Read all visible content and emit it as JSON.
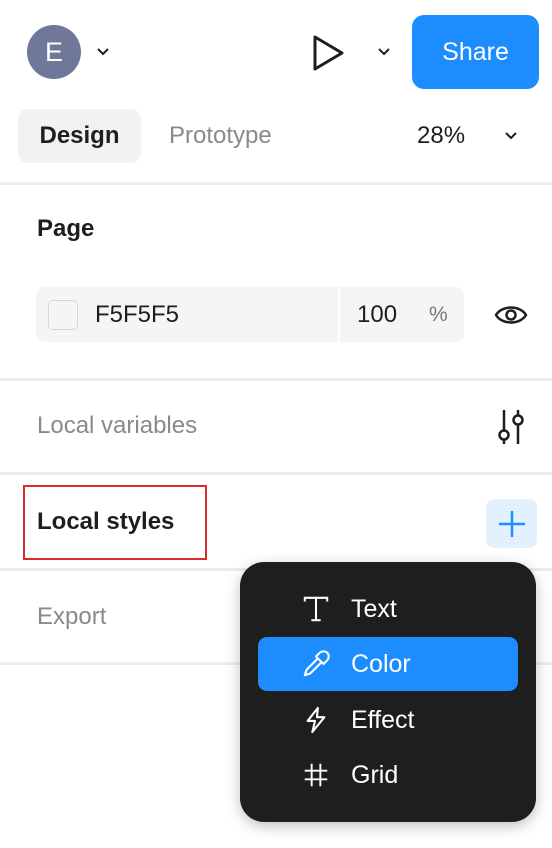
{
  "header": {
    "avatar_initial": "E",
    "share_label": "Share"
  },
  "tabs": {
    "design": "Design",
    "prototype": "Prototype",
    "zoom": "28%"
  },
  "page_section": {
    "title": "Page",
    "color_hex": "F5F5F5",
    "opacity": "100",
    "opacity_unit": "%"
  },
  "local_variables": {
    "label": "Local variables"
  },
  "local_styles": {
    "label": "Local styles"
  },
  "export": {
    "label": "Export"
  },
  "style_menu": {
    "items": [
      {
        "label": "Text",
        "icon": "text-icon"
      },
      {
        "label": "Color",
        "icon": "eyedropper-icon",
        "active": true
      },
      {
        "label": "Effect",
        "icon": "effect-icon"
      },
      {
        "label": "Grid",
        "icon": "grid-icon"
      }
    ]
  },
  "colors": {
    "accent": "#1c8cff",
    "highlight_border": "#d92b2b",
    "menu_bg": "#1e1e1e"
  }
}
